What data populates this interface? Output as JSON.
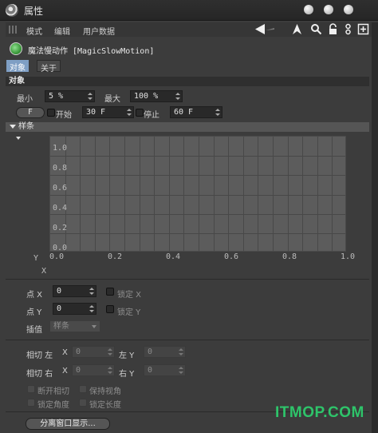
{
  "window": {
    "title": "属性"
  },
  "menu": {
    "items": [
      "模式",
      "编辑",
      "用户数据"
    ]
  },
  "object": {
    "name": "魔法慢动作 [MagicSlowMotion]"
  },
  "tabs": [
    {
      "label": "对象",
      "active": true
    },
    {
      "label": "关于",
      "active": false
    }
  ],
  "section_object": {
    "title": "对象"
  },
  "min": {
    "label": "最小",
    "value": "5 %"
  },
  "max": {
    "label": "最大",
    "value": "100 %"
  },
  "f_button": {
    "label": "F"
  },
  "start": {
    "label": "开始",
    "value": "30 F"
  },
  "stop": {
    "label": "停止",
    "value": "60 F"
  },
  "spline": {
    "title": "样条",
    "y_axis": "Y",
    "x_axis": "X",
    "y_ticks": [
      "1.0",
      "0.8",
      "0.6",
      "0.4",
      "0.2",
      "0.0"
    ],
    "x_ticks": [
      "0.0",
      "0.2",
      "0.4",
      "0.6",
      "0.8",
      "1.0"
    ]
  },
  "point_x": {
    "label": "点 X",
    "value": "0",
    "lock_label": "锁定 X"
  },
  "point_y": {
    "label": "点 Y",
    "value": "0",
    "lock_label": "锁定 Y"
  },
  "interp": {
    "label": "插值",
    "value": "样条"
  },
  "tangent_left": {
    "label": "相切 左",
    "x_label": "X",
    "x_value": "0",
    "y_label": "左 Y",
    "y_value": "0"
  },
  "tangent_right": {
    "label": "相切 右",
    "x_label": "X",
    "x_value": "0",
    "y_label": "右 Y",
    "y_value": "0"
  },
  "options": {
    "break_tangent": "断开相切",
    "keep_visual": "保持视角",
    "lock_angle": "锁定角度",
    "lock_length": "锁定长度"
  },
  "detach_button": {
    "label": "分离窗口显示..."
  },
  "watermark": {
    "text": "ITMOP.COM"
  },
  "colors": {
    "tab_active": "#7f9fc4",
    "watermark": "#2ec46a",
    "graph_bg": "#5c5c5c"
  }
}
